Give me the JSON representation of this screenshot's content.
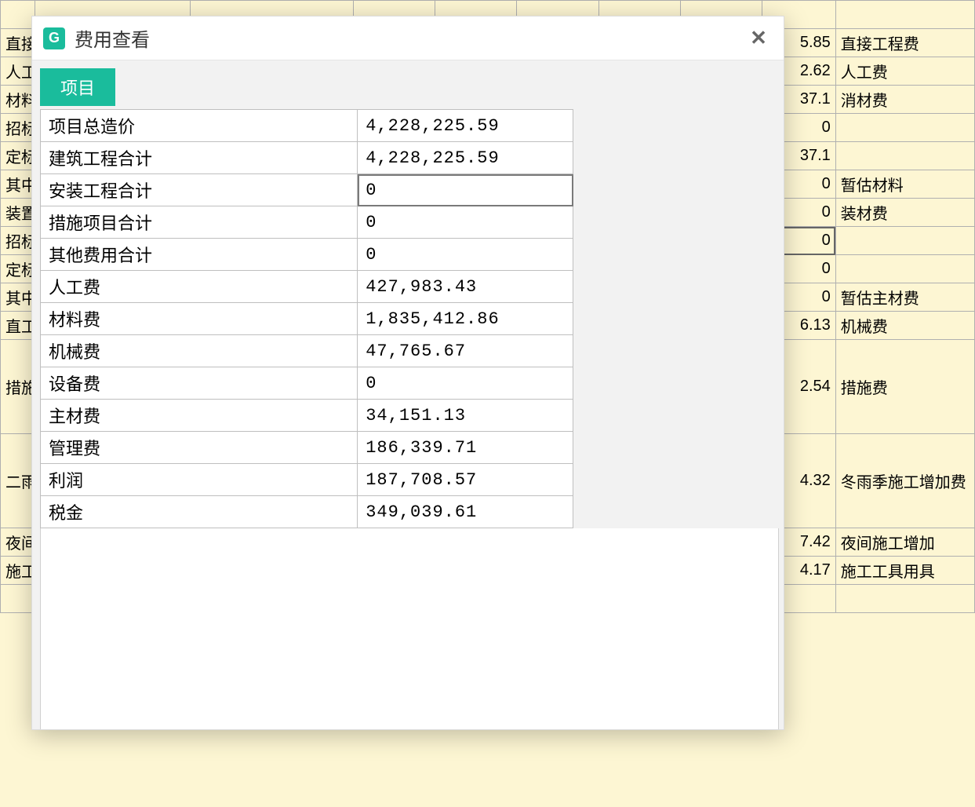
{
  "dialog": {
    "logo_letter": "G",
    "title": "费用查看",
    "tab_label": "项目",
    "rows": [
      {
        "label": "项目总造价",
        "value": "4,228,225.59"
      },
      {
        "label": "建筑工程合计",
        "value": "4,228,225.59"
      },
      {
        "label": "安装工程合计",
        "value": "0",
        "selected": true
      },
      {
        "label": "措施项目合计",
        "value": "0"
      },
      {
        "label": "其他费用合计",
        "value": "0"
      },
      {
        "label": "人工费",
        "value": "427,983.43"
      },
      {
        "label": "材料费",
        "value": "1,835,412.86"
      },
      {
        "label": "机械费",
        "value": "47,765.67"
      },
      {
        "label": "设备费",
        "value": "0"
      },
      {
        "label": "主材费",
        "value": "34,151.13"
      },
      {
        "label": "管理费",
        "value": "186,339.71"
      },
      {
        "label": "利润",
        "value": "187,708.57"
      },
      {
        "label": "税金",
        "value": "349,039.61"
      }
    ]
  },
  "background": {
    "rows": [
      {
        "c0": "",
        "c1": "",
        "c2": ""
      },
      {
        "c0": "直接",
        "c1": "5.85",
        "c2": "直接工程费"
      },
      {
        "c0": "人工",
        "c1": "2.62",
        "c2": "人工费"
      },
      {
        "c0": "材料",
        "c1": "37.1",
        "c2": "消材费"
      },
      {
        "c0": "招标",
        "c1": "0",
        "c2": ""
      },
      {
        "c0": "定标",
        "c1": "37.1",
        "c2": ""
      },
      {
        "c0": "其中",
        "c1": "0",
        "c2": "暂估材料"
      },
      {
        "c0": "装置",
        "c1": "0",
        "c2": "装材费"
      },
      {
        "c0": "招标",
        "c1": "0",
        "c2": "",
        "bgselected": true
      },
      {
        "c0": "定标",
        "c1": "0",
        "c2": ""
      },
      {
        "c0": "其中",
        "c1": "0",
        "c2": "暂估主材费"
      },
      {
        "c0": "直工",
        "c1": "6.13",
        "c2": "机械费"
      },
      {
        "c0": "措施",
        "c1": "2.54",
        "c2": "措施费",
        "tall": true
      },
      {
        "c0": "二雨",
        "c1": "4.32",
        "c2": "冬雨季施工增加费",
        "tall": true
      },
      {
        "c0": "夜间",
        "c1": "7.42",
        "c2": "夜间施工增加"
      },
      {
        "c0": "施工",
        "c1": "4.17",
        "c2": "施工工具用具"
      },
      {
        "c0": "",
        "c1": "",
        "c2": ""
      }
    ]
  }
}
